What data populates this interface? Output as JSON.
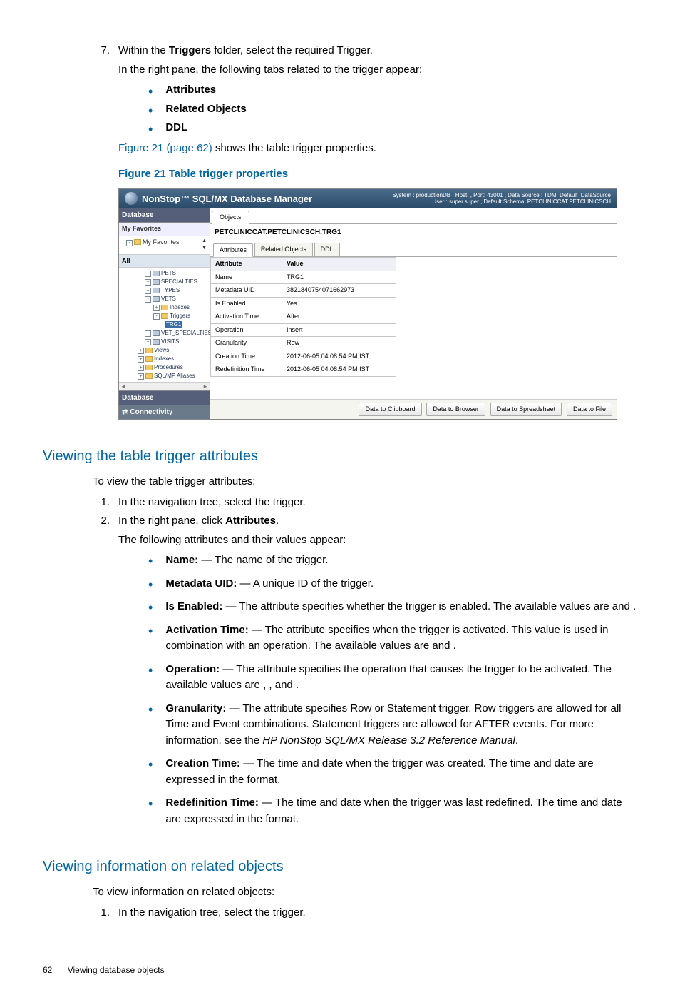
{
  "step7": {
    "num": "7.",
    "line1a": "Within the ",
    "line1b": "Triggers",
    "line1c": " folder, select the required Trigger.",
    "line2": "In the right pane, the following tabs related to the trigger appear:",
    "bullets": [
      "Attributes",
      "Related Objects",
      "DDL"
    ],
    "fig_ref": "Figure 21 (page 62)",
    "fig_ref_tail": " shows the table trigger properties.",
    "fig_caption": "Figure 21 Table trigger properties"
  },
  "app": {
    "title": "NonStop™ SQL/MX Database Manager",
    "header_right_l1": "System : productionDB , Host:                     , Port: 43001 , Data Source : TDM_Default_DataSource",
    "header_right_l2": "User : super.super , Default Schema: PETCLINICCAT.PETCLINICSCH",
    "left_database": "Database",
    "left_myfav": "My Favorites",
    "left_myfav_sub": "My Favorites",
    "left_all": "All",
    "tree": {
      "pets": "PETS",
      "specialties": "SPECIALTIES",
      "types": "TYPES",
      "vets": "VETS",
      "indexes": "Indexes",
      "triggers": "Triggers",
      "trg1": "TRG1",
      "vet_spec": "VET_SPECIALTIES",
      "visits": "VISITS",
      "views": "Views",
      "indexes2": "Indexes",
      "procedures": "Procedures",
      "sqlmp": "SQL/MP Aliases"
    },
    "bottom_tab1": "Database",
    "bottom_tab2": "Connectivity",
    "objects_tab": "Objects",
    "crumb": "PETCLINICCAT.PETCLINICSCH.TRG1",
    "sub_tabs": [
      "Attributes",
      "Related Objects",
      "DDL"
    ],
    "grid_header": [
      "Attribute",
      "Value"
    ],
    "grid_rows": [
      [
        "Name",
        "TRG1"
      ],
      [
        "Metadata UID",
        "382184075407166297​3"
      ],
      [
        "Is Enabled",
        "Yes"
      ],
      [
        "Activation Time",
        "After"
      ],
      [
        "Operation",
        "Insert"
      ],
      [
        "Granularity",
        "Row"
      ],
      [
        "Creation Time",
        "2012-06-05 04:08:54 PM IST"
      ],
      [
        "Redefinition Time",
        "2012-06-05 04:08:54 PM IST"
      ]
    ],
    "buttons": [
      "Data to Clipboard",
      "Data to Browser",
      "Data to Spreadsheet",
      "Data to File"
    ]
  },
  "sec_attrs": {
    "heading": "Viewing the table trigger attributes",
    "intro": "To view the table trigger attributes:",
    "step1_num": "1.",
    "step1": "In the navigation tree, select the trigger.",
    "step2_num": "2.",
    "step2a": "In the right pane, click ",
    "step2b": "Attributes",
    "step2c": ".",
    "step2_after": "The following attributes and their values appear:",
    "items": [
      {
        "k": "Name:",
        "v": " — The name of the trigger."
      },
      {
        "k": "Metadata UID:",
        "v": " — A unique ID of the trigger."
      },
      {
        "k": "Is Enabled:",
        "v": " — The attribute specifies whether the trigger is enabled. The available values are          and       ."
      },
      {
        "k": "Activation Time:",
        "v": " — The attribute specifies when the trigger is activated. This value is used in combination with an operation. The available values are               and            ."
      },
      {
        "k": "Operation:",
        "v": " — The attribute specifies the operation that causes the trigger to be activated. The available values are              ,              , and             ."
      },
      {
        "k": "Granularity:",
        "v": " — The attribute specifies Row or Statement trigger. Row triggers are allowed for all Time and Event combinations. Statement triggers are allowed for AFTER events. For more information, see the ",
        "manual": "HP NonStop SQL/MX Release 3.2 Reference Manual",
        "tail": "."
      },
      {
        "k": "Creation Time:",
        "v": " — The time and date when the trigger was created. The time and date are expressed in the                                                         format."
      },
      {
        "k": "Redefinition Time:",
        "v": " — The time and date when the trigger was last redefined. The time and date are expressed in the                                                                  format."
      }
    ]
  },
  "sec_related": {
    "heading": "Viewing information on related objects",
    "intro": "To view information on related objects:",
    "step1_num": "1.",
    "step1": "In the navigation tree, select the trigger."
  },
  "footer": {
    "page": "62",
    "title": "Viewing database objects"
  },
  "chart_data": {
    "type": "table",
    "title": "Table trigger properties — Attributes",
    "columns": [
      "Attribute",
      "Value"
    ],
    "rows": [
      [
        "Name",
        "TRG1"
      ],
      [
        "Metadata UID",
        "3821840754071662973"
      ],
      [
        "Is Enabled",
        "Yes"
      ],
      [
        "Activation Time",
        "After"
      ],
      [
        "Operation",
        "Insert"
      ],
      [
        "Granularity",
        "Row"
      ],
      [
        "Creation Time",
        "2012-06-05 04:08:54 PM IST"
      ],
      [
        "Redefinition Time",
        "2012-06-05 04:08:54 PM IST"
      ]
    ]
  }
}
